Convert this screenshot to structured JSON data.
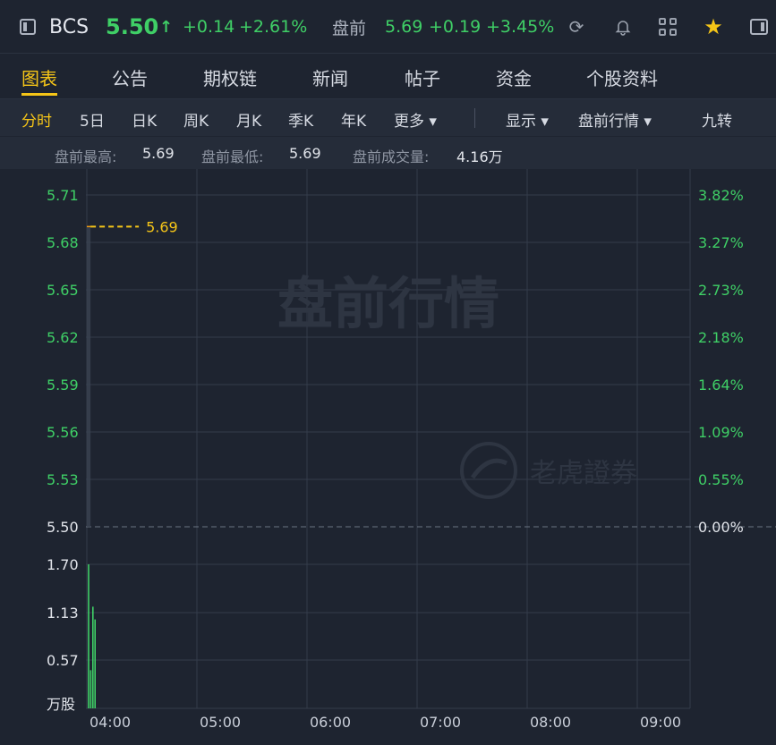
{
  "header": {
    "symbol": "BCS",
    "price": "5.50",
    "arrow": "↑",
    "change": "+0.14",
    "change_pct": "+2.61%",
    "premarket_label": "盘前",
    "premarket_price": "5.69",
    "premarket_change": "+0.19",
    "premarket_change_pct": "+3.45%",
    "icons": [
      "refresh-icon",
      "bell-icon",
      "grid-icon",
      "star-icon",
      "panel-icon"
    ]
  },
  "tabs": [
    {
      "label": "图表",
      "active": true
    },
    {
      "label": "公告"
    },
    {
      "label": "期权链"
    },
    {
      "label": "新闻"
    },
    {
      "label": "帖子"
    },
    {
      "label": "资金"
    },
    {
      "label": "个股资料"
    }
  ],
  "toolbar": {
    "periods": [
      "分时",
      "5日",
      "日K",
      "周K",
      "月K",
      "季K",
      "年K"
    ],
    "more": "更多 ▾",
    "display": "显示 ▾",
    "premarket": "盘前行情 ▾",
    "nine": "九转"
  },
  "stats": {
    "high_label": "盘前最高:",
    "high": "5.69",
    "low_label": "盘前最低:",
    "low": "5.69",
    "volume_label": "盘前成交量:",
    "volume": "4.16万"
  },
  "watermark": {
    "title": "盘前行情",
    "brand": "老虎證券"
  },
  "colors": {
    "up": "#3fcf66",
    "accent": "#f5c518",
    "background": "#1e2430"
  },
  "chart_data": {
    "type": "line",
    "title": "",
    "price_axis_left": [
      "5.71",
      "5.68",
      "5.65",
      "5.62",
      "5.59",
      "5.56",
      "5.53",
      "5.50"
    ],
    "price_axis_right": [
      "3.82%",
      "3.27%",
      "2.73%",
      "2.18%",
      "1.64%",
      "1.09%",
      "0.55%",
      "0.00%"
    ],
    "volume_axis": [
      "1.70",
      "1.13",
      "0.57",
      "万股"
    ],
    "x_labels": [
      "04:00",
      "05:00",
      "06:00",
      "07:00",
      "08:00",
      "09:00"
    ],
    "ylim": [
      5.5,
      5.71
    ],
    "prev_close": 5.5,
    "last_price_label": "5.69",
    "series": [
      {
        "name": "price",
        "x": [
          "04:00",
          "04:01",
          "04:02"
        ],
        "values": [
          5.69,
          5.69,
          5.69
        ]
      }
    ],
    "volume": {
      "unit": "万股",
      "ylim": [
        0,
        1.7
      ],
      "bars": [
        {
          "x": "04:00",
          "value": 1.7
        },
        {
          "x": "04:01",
          "value": 0.45
        },
        {
          "x": "04:02",
          "value": 1.2
        },
        {
          "x": "04:03",
          "value": 1.05
        }
      ]
    }
  }
}
